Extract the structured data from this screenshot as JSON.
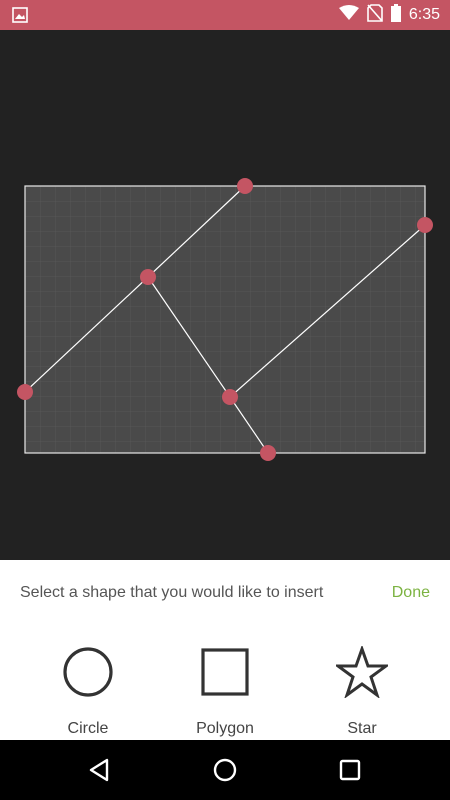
{
  "status_bar": {
    "time": "6:35",
    "left_icon": "image-icon",
    "right_icons": [
      "wifi-icon",
      "no-sim-icon",
      "battery-icon"
    ],
    "color": "#c45563"
  },
  "editor": {
    "canvas_color": "#4a4a4a",
    "handle_color": "#c45563",
    "line_color": "#ffffff"
  },
  "shape_picker": {
    "prompt": "Select a shape that you would like to insert",
    "done_label": "Done",
    "options": [
      {
        "label": "Circle",
        "icon": "circle-icon"
      },
      {
        "label": "Polygon",
        "icon": "square-icon"
      },
      {
        "label": "Star",
        "icon": "star-icon"
      }
    ]
  },
  "nav_bar": {
    "buttons": [
      "back-icon",
      "home-icon",
      "recents-icon"
    ]
  }
}
